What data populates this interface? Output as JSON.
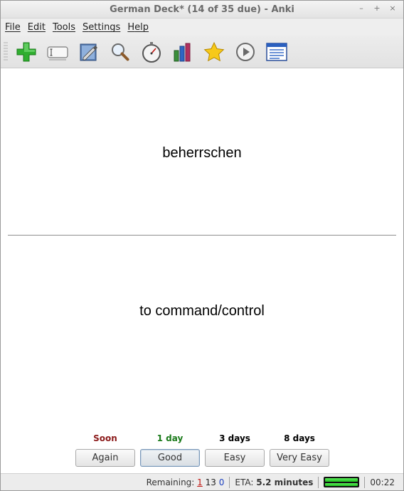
{
  "window": {
    "title": "German Deck* (14 of 35 due) - Anki",
    "controls": [
      "–",
      "+",
      "×"
    ]
  },
  "menubar": {
    "items": [
      {
        "mnemonic": "F",
        "rest": "ile"
      },
      {
        "mnemonic": "E",
        "rest": "dit"
      },
      {
        "mnemonic": "T",
        "rest": "ools"
      },
      {
        "mnemonic": "S",
        "rest": "ettings"
      },
      {
        "mnemonic": "H",
        "rest": "elp"
      }
    ]
  },
  "toolbar": {
    "icons": [
      "add-icon",
      "edit-current-icon",
      "edit-layout-icon",
      "browse-icon",
      "timer-icon",
      "stats-icon",
      "mark-star-icon",
      "replay-audio-icon",
      "card-info-icon"
    ]
  },
  "card": {
    "front": "beherrschen",
    "back": "to command/control"
  },
  "answers": [
    {
      "interval": "Soon",
      "label": "Again",
      "color": "#8b1a1a"
    },
    {
      "interval": "1 day",
      "label": "Good",
      "color": "#1a7a1a"
    },
    {
      "interval": "3 days",
      "label": "Easy",
      "color": "#000000"
    },
    {
      "interval": "8 days",
      "label": "Very Easy",
      "color": "#000000"
    }
  ],
  "status": {
    "remaining_label": "Remaining:",
    "new_count": "1",
    "learning_count": "13",
    "review_count": "0",
    "eta_label": "ETA:",
    "eta_value": "5.2 minutes",
    "progress": 1.0,
    "timer": "00:22"
  }
}
